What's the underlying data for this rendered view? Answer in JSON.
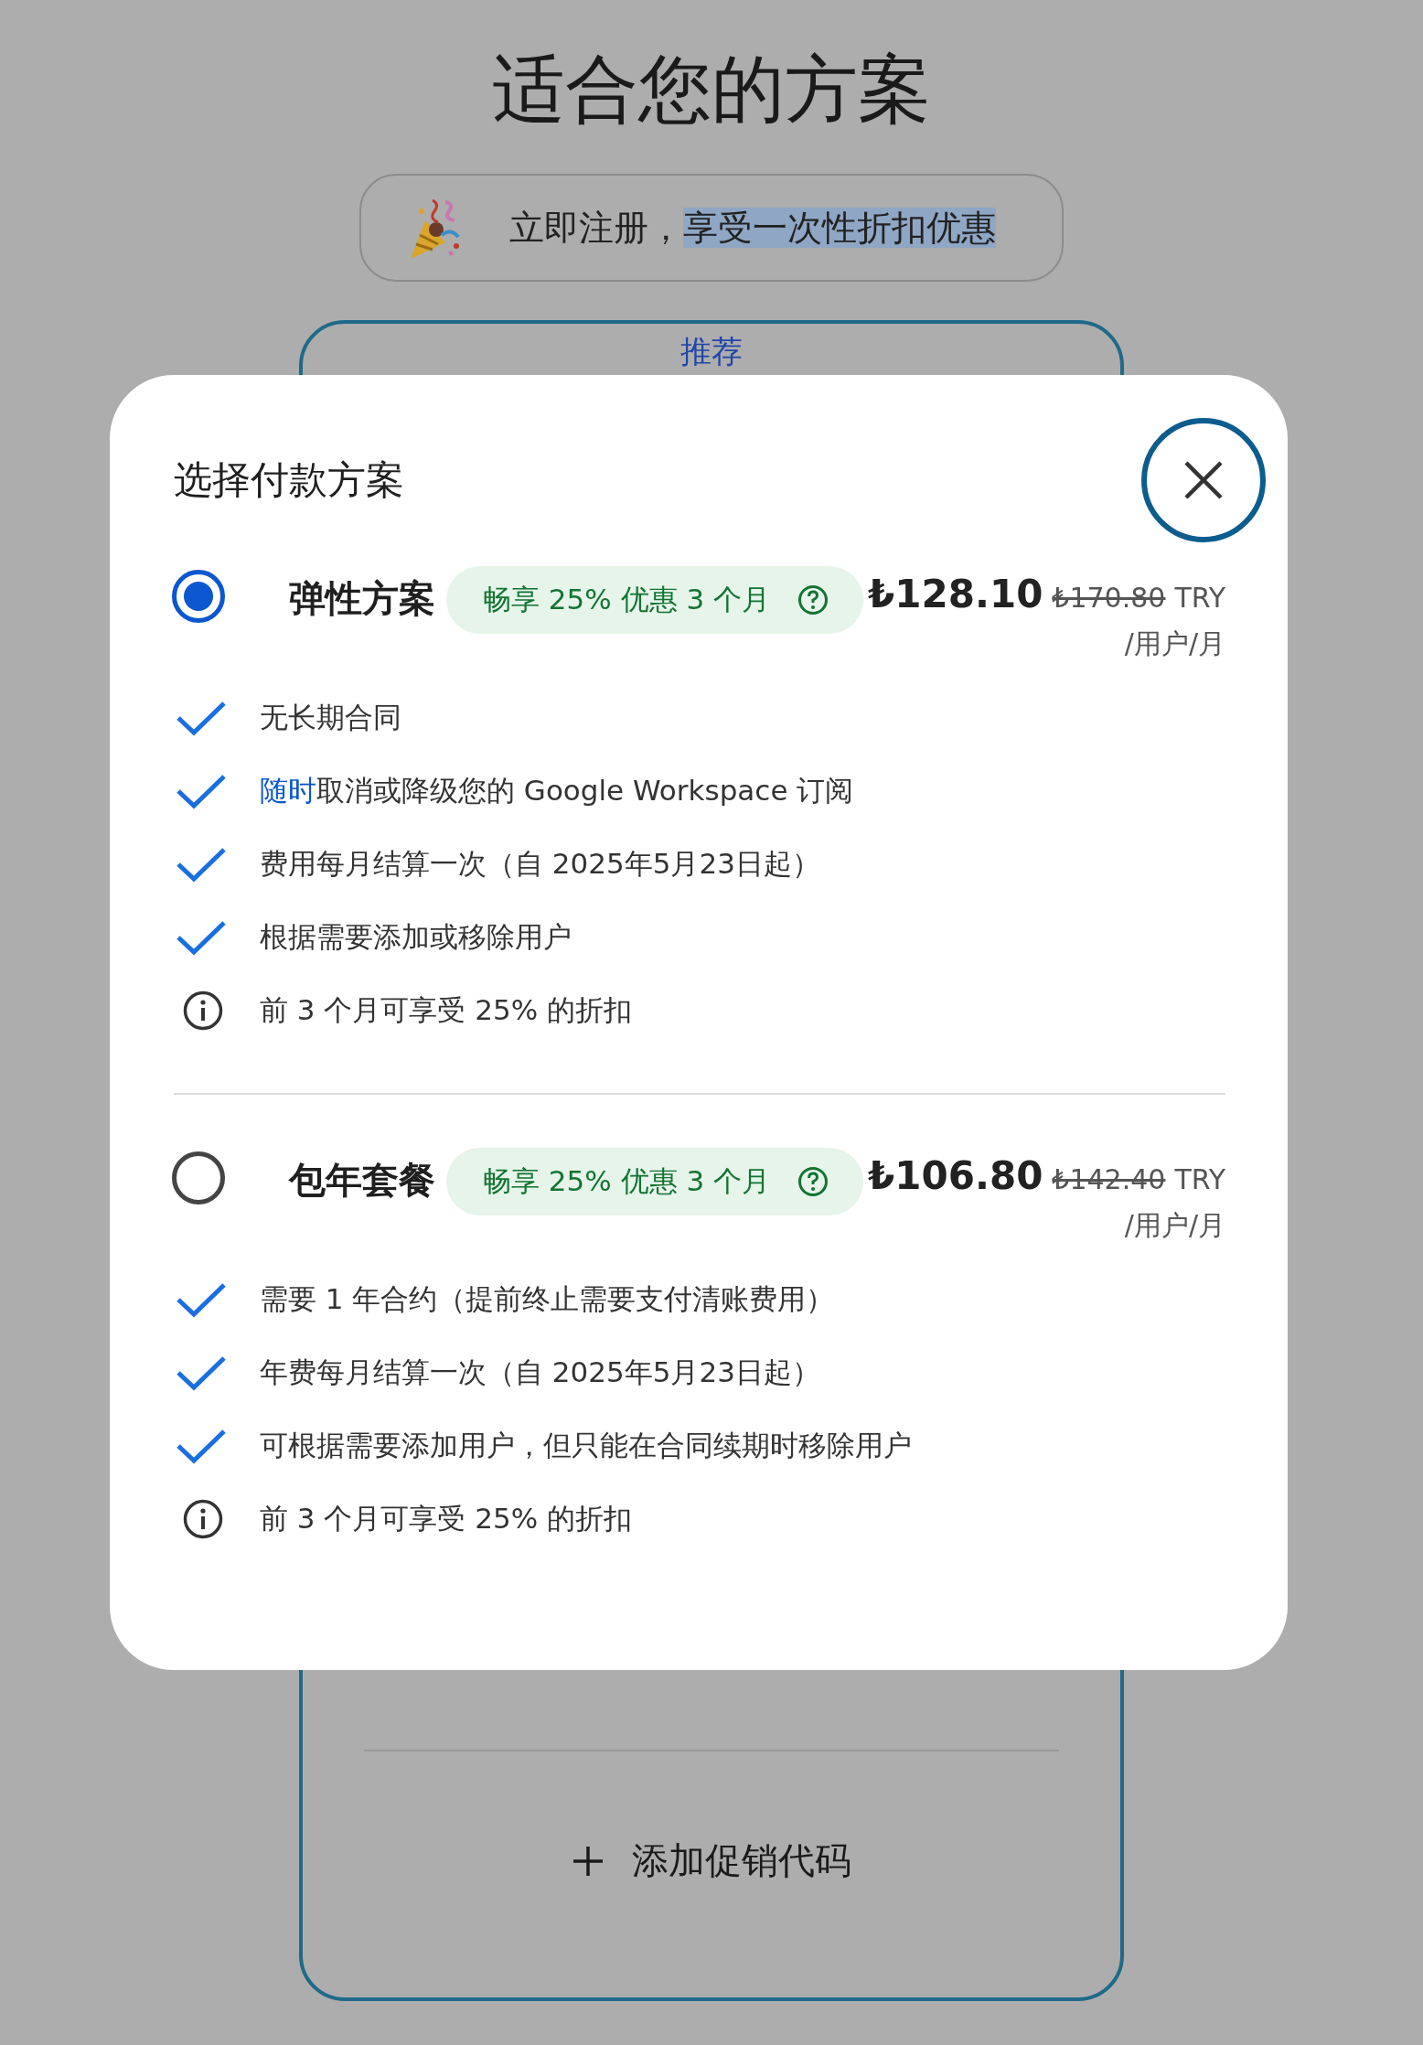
{
  "page_title": "适合您的方案",
  "banner": {
    "text": "立即注册，",
    "highlighted_text": "享受一次性折扣优惠"
  },
  "plan_card": {
    "tag": "推荐",
    "promo_button": "添加促销代码"
  },
  "dialog": {
    "title": "选择付款方案",
    "plans": [
      {
        "name": "弹性方案",
        "selected": true,
        "badge": "畅享 25% 优惠 3 个月",
        "price": "₺128.10",
        "old_price": "₺170.80",
        "currency": "TRY",
        "unit": "/用户/月",
        "features": [
          {
            "kind": "check",
            "text": "无长期合同"
          },
          {
            "kind": "check",
            "link": "随时",
            "text": "取消或降级您的 Google Workspace 订阅"
          },
          {
            "kind": "check",
            "text": "费用每月结算一次（自 2025年5月23日起）"
          },
          {
            "kind": "check",
            "text": "根据需要添加或移除用户"
          },
          {
            "kind": "info",
            "text": "前 3 个月可享受 25% 的折扣"
          }
        ]
      },
      {
        "name": "包年套餐",
        "selected": false,
        "badge": "畅享 25% 优惠 3 个月",
        "price": "₺106.80",
        "old_price": "₺142.40",
        "currency": "TRY",
        "unit": "/用户/月",
        "features": [
          {
            "kind": "check",
            "text": "需要 1 年合约（提前终止需要支付清账费用）"
          },
          {
            "kind": "check",
            "text": "年费每月结算一次（自 2025年5月23日起）"
          },
          {
            "kind": "check",
            "text": "可根据需要添加用户，但只能在合同续期时移除用户"
          },
          {
            "kind": "info",
            "text": "前 3 个月可享受 25% 的折扣"
          }
        ]
      }
    ]
  }
}
